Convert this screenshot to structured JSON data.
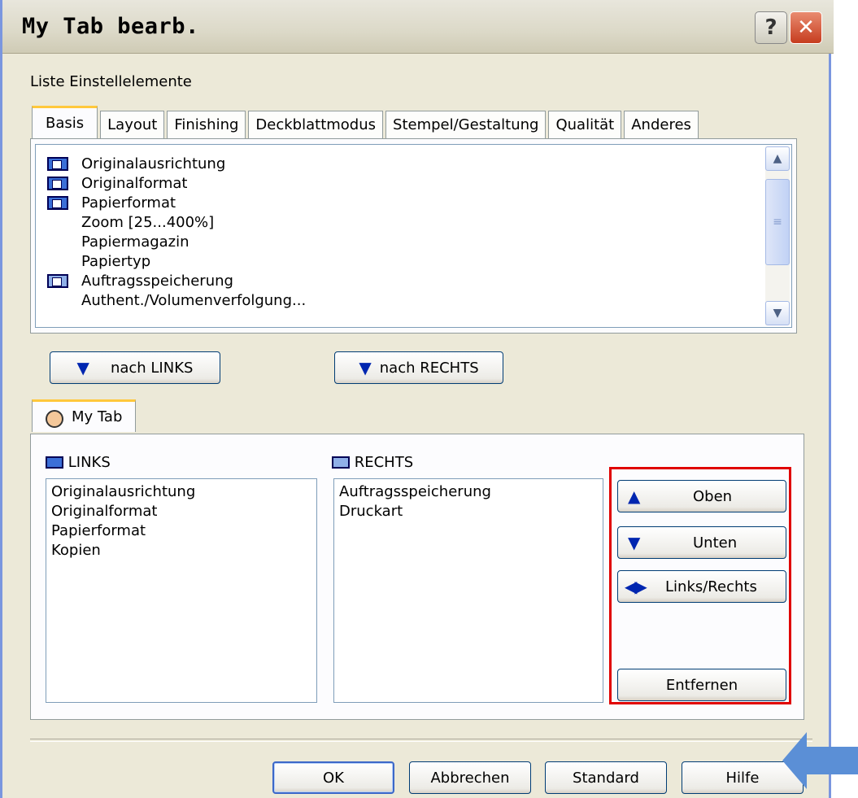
{
  "window": {
    "title": "My Tab bearb.",
    "help_glyph": "?",
    "close_glyph": "✕"
  },
  "settings": {
    "label": "Liste Einstellelemente",
    "tabs": [
      "Basis",
      "Layout",
      "Finishing",
      "Deckblattmodus",
      "Stempel/Gestaltung",
      "Qualität",
      "Anderes"
    ],
    "active_tab": "Basis",
    "items": [
      {
        "label": "Originalausrichtung",
        "icon": "settings-item-icon"
      },
      {
        "label": "Originalformat",
        "icon": "settings-item-icon"
      },
      {
        "label": "Papierformat",
        "icon": "settings-item-icon"
      },
      {
        "label": "Zoom [25...400%]",
        "icon": ""
      },
      {
        "label": "Papiermagazin",
        "icon": ""
      },
      {
        "label": "Papiertyp",
        "icon": ""
      },
      {
        "label": "Auftragsspeicherung",
        "icon": "settings-item-icon-alt"
      },
      {
        "label": "Authent./Volumenverfolgung...",
        "icon": ""
      }
    ]
  },
  "move": {
    "left_label": "nach LINKS",
    "right_label": "nach RECHTS"
  },
  "mytab": {
    "tab_label": "My Tab",
    "links_label": "LINKS",
    "rechts_label": "RECHTS",
    "links_items": [
      "Originalausrichtung",
      "Originalformat",
      "Papierformat",
      "Kopien"
    ],
    "rechts_items": [
      "Auftragsspeicherung",
      "Druckart"
    ]
  },
  "order_buttons": {
    "up": "Oben",
    "down": "Unten",
    "swap": "Links/Rechts",
    "remove": "Entfernen"
  },
  "footer": {
    "ok": "OK",
    "cancel": "Abbrechen",
    "standard": "Standard",
    "help": "Hilfe"
  },
  "colors": {
    "highlight_box": "#e00000",
    "pointer_arrow": "#5b8fd6",
    "accent": "#0026b0"
  }
}
